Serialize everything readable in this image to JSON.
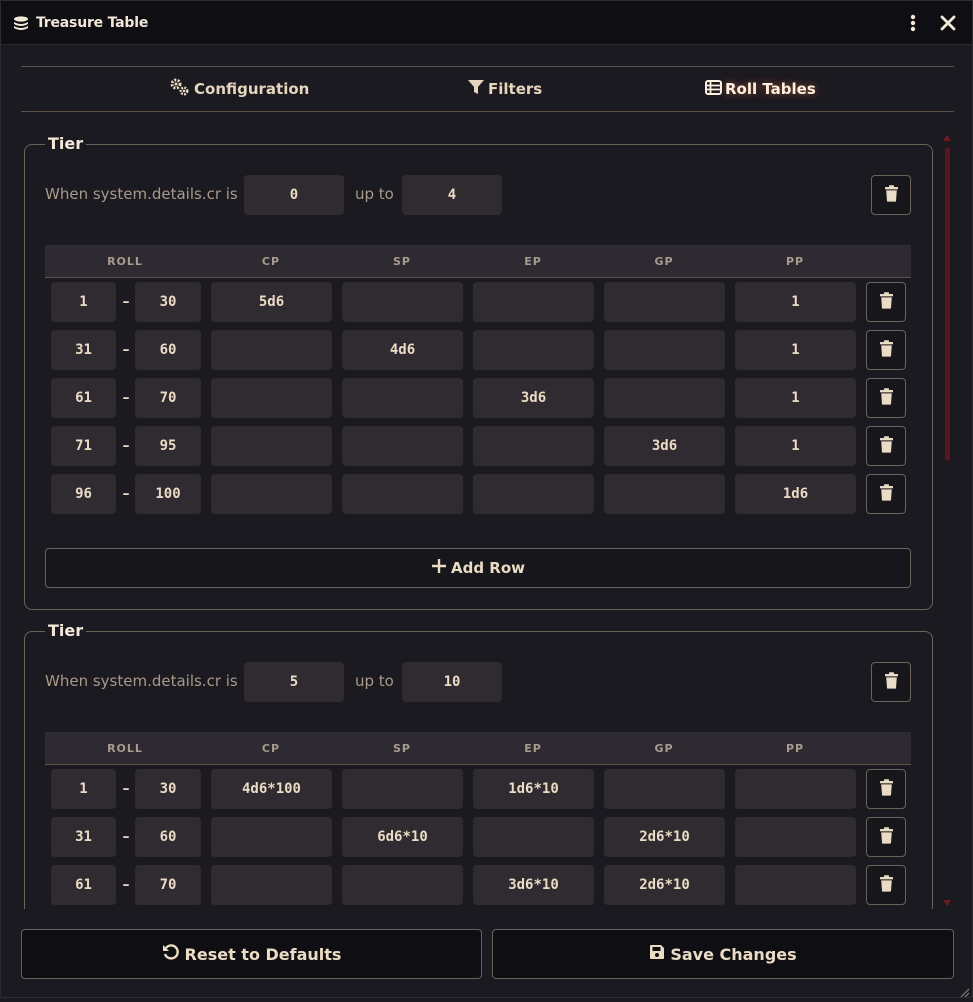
{
  "window": {
    "title": "Treasure Table",
    "logo_icon": "coins-icon",
    "menu_icon": "vertical-ellipsis-icon",
    "close_icon": "close-icon"
  },
  "tabs": [
    {
      "label": "Configuration",
      "icon": "cogs-icon",
      "active": false
    },
    {
      "label": "Filters",
      "icon": "filter-icon",
      "active": false
    },
    {
      "label": "Roll Tables",
      "icon": "table-list-icon",
      "active": true
    }
  ],
  "columns": [
    "ROLL",
    "CP",
    "SP",
    "EP",
    "GP",
    "PP"
  ],
  "tiers": [
    {
      "legend": "Tier",
      "condition_label": "When system.details.cr is",
      "from": "0",
      "upto_label": "up to",
      "to": "4",
      "rows": [
        {
          "min": "1",
          "max": "30",
          "cp": "5d6",
          "sp": "",
          "ep": "",
          "gp": "",
          "pp": "1"
        },
        {
          "min": "31",
          "max": "60",
          "cp": "",
          "sp": "4d6",
          "ep": "",
          "gp": "",
          "pp": "1"
        },
        {
          "min": "61",
          "max": "70",
          "cp": "",
          "sp": "",
          "ep": "3d6",
          "gp": "",
          "pp": "1"
        },
        {
          "min": "71",
          "max": "95",
          "cp": "",
          "sp": "",
          "ep": "",
          "gp": "3d6",
          "pp": "1"
        },
        {
          "min": "96",
          "max": "100",
          "cp": "",
          "sp": "",
          "ep": "",
          "gp": "",
          "pp": "1d6"
        }
      ],
      "add_row_label": "Add Row"
    },
    {
      "legend": "Tier",
      "condition_label": "When system.details.cr is",
      "from": "5",
      "upto_label": "up to",
      "to": "10",
      "rows": [
        {
          "min": "1",
          "max": "30",
          "cp": "4d6*100",
          "sp": "",
          "ep": "1d6*10",
          "gp": "",
          "pp": ""
        },
        {
          "min": "31",
          "max": "60",
          "cp": "",
          "sp": "6d6*10",
          "ep": "",
          "gp": "2d6*10",
          "pp": ""
        },
        {
          "min": "61",
          "max": "70",
          "cp": "",
          "sp": "",
          "ep": "3d6*10",
          "gp": "2d6*10",
          "pp": ""
        }
      ]
    }
  ],
  "footer": {
    "reset_label": "Reset to Defaults",
    "save_label": "Save Changes"
  },
  "colors": {
    "background": "#1b1a20",
    "titlebar": "#0f0e12",
    "input": "#302b31",
    "border": "#6b625a",
    "text": "#eadbc5",
    "muted": "#a8998a",
    "scrollbar": "#5c1420"
  }
}
